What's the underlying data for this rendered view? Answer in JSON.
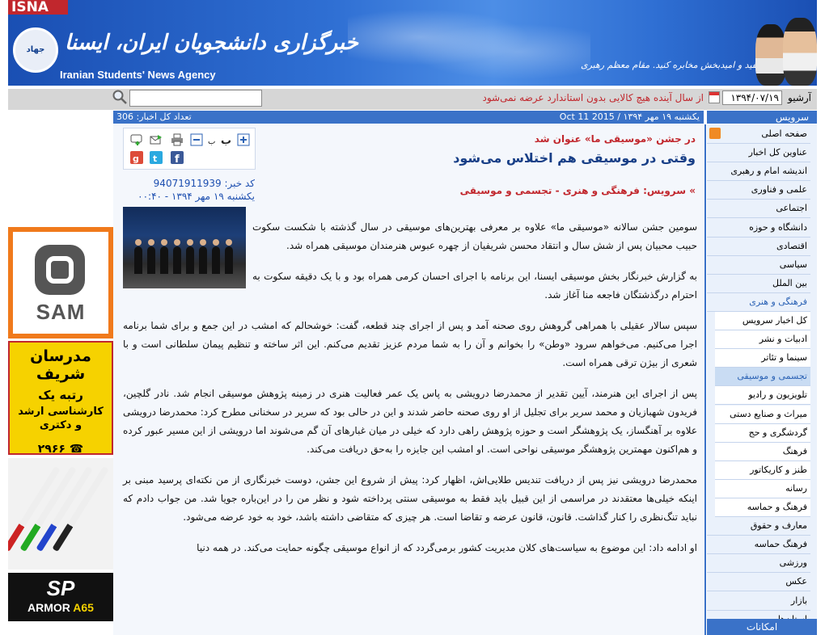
{
  "header": {
    "isna_tab": "ISNA",
    "logo_text": "جهاد",
    "agency_name_fa": "خبرگزاری دانشجویان ایران، ایسنا",
    "agency_name_en": "Iranian Students' News Agency",
    "slogan": "اخبار خوب، مفید و امیدبخش مخابره کنید. مقام معظم رهبری"
  },
  "toolbar": {
    "archive_label": "آرشیو",
    "date_value": "۱۳۹۴/۰۷/۱۹",
    "ticker": "از سال آینده هیچ کالایی بدون استاندارد عرضه نمی‌شود",
    "search_placeholder": ""
  },
  "infobar": {
    "date_line": "یکشنبه ۱۹ مهر ۱۳۹۴ / 2015 Oct 11",
    "news_count": "تعداد کل اخبار: 306",
    "services_head": "سرویس"
  },
  "sidebar": {
    "items": [
      {
        "label": "صفحه اصلی",
        "type": "main"
      },
      {
        "label": "عناوین کل اخبار",
        "type": "main"
      },
      {
        "label": "اندیشه امام و رهبری",
        "type": "main"
      },
      {
        "label": "علمی و فناوری",
        "type": "main"
      },
      {
        "label": "اجتماعی",
        "type": "main"
      },
      {
        "label": "دانشگاه و حوزه",
        "type": "main"
      },
      {
        "label": "اقتصادی",
        "type": "main"
      },
      {
        "label": "سیاسی",
        "type": "main"
      },
      {
        "label": "بین الملل",
        "type": "main"
      },
      {
        "label": "فرهنگی و هنری",
        "type": "parent"
      },
      {
        "label": "کل اخبار سرویس",
        "type": "sub"
      },
      {
        "label": "ادبیات و نشر",
        "type": "sub"
      },
      {
        "label": "سینما و تئاتر",
        "type": "sub"
      },
      {
        "label": "تجسمی و موسیقی",
        "type": "current"
      },
      {
        "label": "تلویزیون و رادیو",
        "type": "sub"
      },
      {
        "label": "میراث و صنایع دستی",
        "type": "sub"
      },
      {
        "label": "گردشگری و حج",
        "type": "sub"
      },
      {
        "label": "فرهنگ",
        "type": "sub"
      },
      {
        "label": "طنز و کاریکاتور",
        "type": "sub"
      },
      {
        "label": "رسانه",
        "type": "sub"
      },
      {
        "label": "فرهنگ و حماسه",
        "type": "sub"
      },
      {
        "label": "معارف و حقوق",
        "type": "main"
      },
      {
        "label": "فرهنگ حماسه",
        "type": "main"
      },
      {
        "label": "ورزشی",
        "type": "main"
      },
      {
        "label": "عکس",
        "type": "main"
      },
      {
        "label": "بازار",
        "type": "main"
      },
      {
        "label": "استان‌ها",
        "type": "main"
      }
    ],
    "footer": "امکانات"
  },
  "ads": {
    "sam": "SAM",
    "madresan": [
      "مدرسان شریف",
      "رتبه یک",
      "کارشناسی ارشد",
      "و دکتری",
      "۲۹۶۶"
    ],
    "sp_brand": "SP",
    "sp_model_prefix": "ARMOR ",
    "sp_model": "A65"
  },
  "article": {
    "kicker": "در جشن «موسیقی ما» عنوان شد",
    "headline": "وقتی در موسیقی هم اختلاس می‌شود",
    "news_code": "کد خبر: 94071911939",
    "news_date": "یکشنبه ۱۹ مهر ۱۳۹۴ - ۰۰:۴۰",
    "service_line": "» سرویس: فرهنگی و هنری - تجسمی و موسیقی",
    "paragraphs": [
      "سومین جشن سالانه «موسیقی ما» علاوه بر معرفی بهترین‌های موسیقی در سال گذشته با شکست سکوت حبیب محبیان پس از شش سال و انتقاد محسن شریفیان از چهره عبوس هنرمندان موسیقی همراه شد.",
      "به گزارش خبرنگار بخش موسیقی ایسنا، این برنامه با اجرای احسان کرمی همراه بود و با یک دقیقه سکوت به احترام درگذشتگان فاجعه منا آغاز شد.",
      "سپس سالار عقیلی با همراهی گروهش روی صحنه آمد و پس از اجرای چند قطعه، گفت: خوشحالم که امشب در این جمع و برای شما برنامه اجرا می‌کنیم. می‌خواهم سرود «وطن» را بخوانم و آن را به شما مردم عزیز تقدیم می‌کنم. این اثر ساخته و تنظیم پیمان سلطانی است و با شعری از بیژن ترقی همراه است.",
      "پس از اجرای این هنرمند، آیین تقدیر از محمدرضا درویشی به پاس یک عمر فعالیت هنری در زمینه پژوهش موسیقی انجام شد. نادر گلچین، فریدون شهبازیان و محمد سریر برای تجلیل از او روی صحنه حاضر شدند و این در حالی بود که سریر در سخنانی مطرح کرد: محمدرضا درویشی علاوه بر آهنگساز، یک پژوهشگر است و حوزه پژوهش راهی دارد که خیلی در میان غبارهای آن گم می‌شوند اما درویشی از این مسیر عبور کرده و هم‌اکنون مهمترین پژوهشگر موسیقی نواحی است. او امشب این جایزه را به‌حق دریافت می‌کند.",
      "محمدرضا درویشی نیز پس از دریافت تندیس طلایی‌اش، اظهار کرد: پیش از شروع این جشن، دوست خبرنگاری از من نکته‌ای پرسید مبنی بر اینکه خیلی‌ها معتقدند در مراسمی از این قبیل باید فقط به موسیقی سنتی پرداخته شود و نظر من را در این‌باره جویا شد. من جواب دادم که نباید تنگ‌نظری را کنار گذاشت. قانون، قانون عرضه و تقاضا است. هر چیزی که متقاضی داشته باشد، خود به خود عرضه می‌شود.",
      "او ادامه داد: این موضوع به سیاست‌های کلان مدیریت کشور برمی‌گردد که از انواع موسیقی چگونه حمایت می‌کند. در همه دنیا"
    ]
  },
  "colors": {
    "header_blue": "#2f6fd3",
    "bar_blue": "#3a72c8",
    "accent_red": "#c1272d",
    "headline_blue": "#183f87"
  }
}
